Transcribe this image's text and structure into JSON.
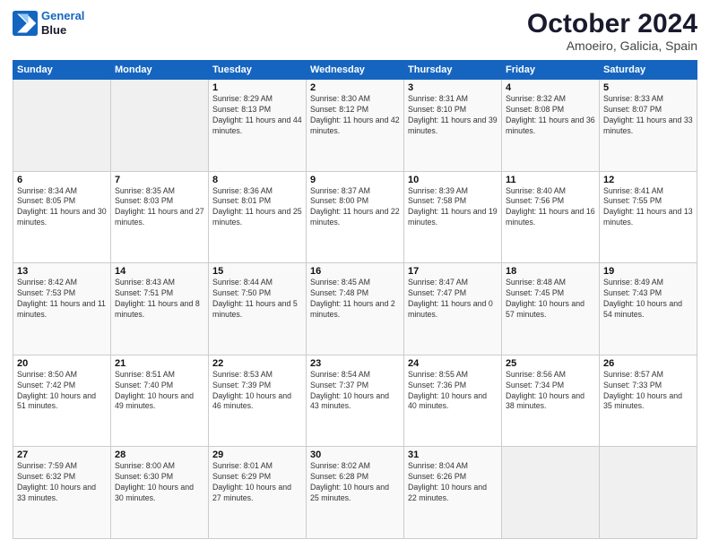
{
  "header": {
    "logo_line1": "General",
    "logo_line2": "Blue",
    "month": "October 2024",
    "location": "Amoeiro, Galicia, Spain"
  },
  "weekdays": [
    "Sunday",
    "Monday",
    "Tuesday",
    "Wednesday",
    "Thursday",
    "Friday",
    "Saturday"
  ],
  "weeks": [
    [
      {
        "day": "",
        "info": ""
      },
      {
        "day": "",
        "info": ""
      },
      {
        "day": "1",
        "info": "Sunrise: 8:29 AM\nSunset: 8:13 PM\nDaylight: 11 hours and 44 minutes."
      },
      {
        "day": "2",
        "info": "Sunrise: 8:30 AM\nSunset: 8:12 PM\nDaylight: 11 hours and 42 minutes."
      },
      {
        "day": "3",
        "info": "Sunrise: 8:31 AM\nSunset: 8:10 PM\nDaylight: 11 hours and 39 minutes."
      },
      {
        "day": "4",
        "info": "Sunrise: 8:32 AM\nSunset: 8:08 PM\nDaylight: 11 hours and 36 minutes."
      },
      {
        "day": "5",
        "info": "Sunrise: 8:33 AM\nSunset: 8:07 PM\nDaylight: 11 hours and 33 minutes."
      }
    ],
    [
      {
        "day": "6",
        "info": "Sunrise: 8:34 AM\nSunset: 8:05 PM\nDaylight: 11 hours and 30 minutes."
      },
      {
        "day": "7",
        "info": "Sunrise: 8:35 AM\nSunset: 8:03 PM\nDaylight: 11 hours and 27 minutes."
      },
      {
        "day": "8",
        "info": "Sunrise: 8:36 AM\nSunset: 8:01 PM\nDaylight: 11 hours and 25 minutes."
      },
      {
        "day": "9",
        "info": "Sunrise: 8:37 AM\nSunset: 8:00 PM\nDaylight: 11 hours and 22 minutes."
      },
      {
        "day": "10",
        "info": "Sunrise: 8:39 AM\nSunset: 7:58 PM\nDaylight: 11 hours and 19 minutes."
      },
      {
        "day": "11",
        "info": "Sunrise: 8:40 AM\nSunset: 7:56 PM\nDaylight: 11 hours and 16 minutes."
      },
      {
        "day": "12",
        "info": "Sunrise: 8:41 AM\nSunset: 7:55 PM\nDaylight: 11 hours and 13 minutes."
      }
    ],
    [
      {
        "day": "13",
        "info": "Sunrise: 8:42 AM\nSunset: 7:53 PM\nDaylight: 11 hours and 11 minutes."
      },
      {
        "day": "14",
        "info": "Sunrise: 8:43 AM\nSunset: 7:51 PM\nDaylight: 11 hours and 8 minutes."
      },
      {
        "day": "15",
        "info": "Sunrise: 8:44 AM\nSunset: 7:50 PM\nDaylight: 11 hours and 5 minutes."
      },
      {
        "day": "16",
        "info": "Sunrise: 8:45 AM\nSunset: 7:48 PM\nDaylight: 11 hours and 2 minutes."
      },
      {
        "day": "17",
        "info": "Sunrise: 8:47 AM\nSunset: 7:47 PM\nDaylight: 11 hours and 0 minutes."
      },
      {
        "day": "18",
        "info": "Sunrise: 8:48 AM\nSunset: 7:45 PM\nDaylight: 10 hours and 57 minutes."
      },
      {
        "day": "19",
        "info": "Sunrise: 8:49 AM\nSunset: 7:43 PM\nDaylight: 10 hours and 54 minutes."
      }
    ],
    [
      {
        "day": "20",
        "info": "Sunrise: 8:50 AM\nSunset: 7:42 PM\nDaylight: 10 hours and 51 minutes."
      },
      {
        "day": "21",
        "info": "Sunrise: 8:51 AM\nSunset: 7:40 PM\nDaylight: 10 hours and 49 minutes."
      },
      {
        "day": "22",
        "info": "Sunrise: 8:53 AM\nSunset: 7:39 PM\nDaylight: 10 hours and 46 minutes."
      },
      {
        "day": "23",
        "info": "Sunrise: 8:54 AM\nSunset: 7:37 PM\nDaylight: 10 hours and 43 minutes."
      },
      {
        "day": "24",
        "info": "Sunrise: 8:55 AM\nSunset: 7:36 PM\nDaylight: 10 hours and 40 minutes."
      },
      {
        "day": "25",
        "info": "Sunrise: 8:56 AM\nSunset: 7:34 PM\nDaylight: 10 hours and 38 minutes."
      },
      {
        "day": "26",
        "info": "Sunrise: 8:57 AM\nSunset: 7:33 PM\nDaylight: 10 hours and 35 minutes."
      }
    ],
    [
      {
        "day": "27",
        "info": "Sunrise: 7:59 AM\nSunset: 6:32 PM\nDaylight: 10 hours and 33 minutes."
      },
      {
        "day": "28",
        "info": "Sunrise: 8:00 AM\nSunset: 6:30 PM\nDaylight: 10 hours and 30 minutes."
      },
      {
        "day": "29",
        "info": "Sunrise: 8:01 AM\nSunset: 6:29 PM\nDaylight: 10 hours and 27 minutes."
      },
      {
        "day": "30",
        "info": "Sunrise: 8:02 AM\nSunset: 6:28 PM\nDaylight: 10 hours and 25 minutes."
      },
      {
        "day": "31",
        "info": "Sunrise: 8:04 AM\nSunset: 6:26 PM\nDaylight: 10 hours and 22 minutes."
      },
      {
        "day": "",
        "info": ""
      },
      {
        "day": "",
        "info": ""
      }
    ]
  ]
}
